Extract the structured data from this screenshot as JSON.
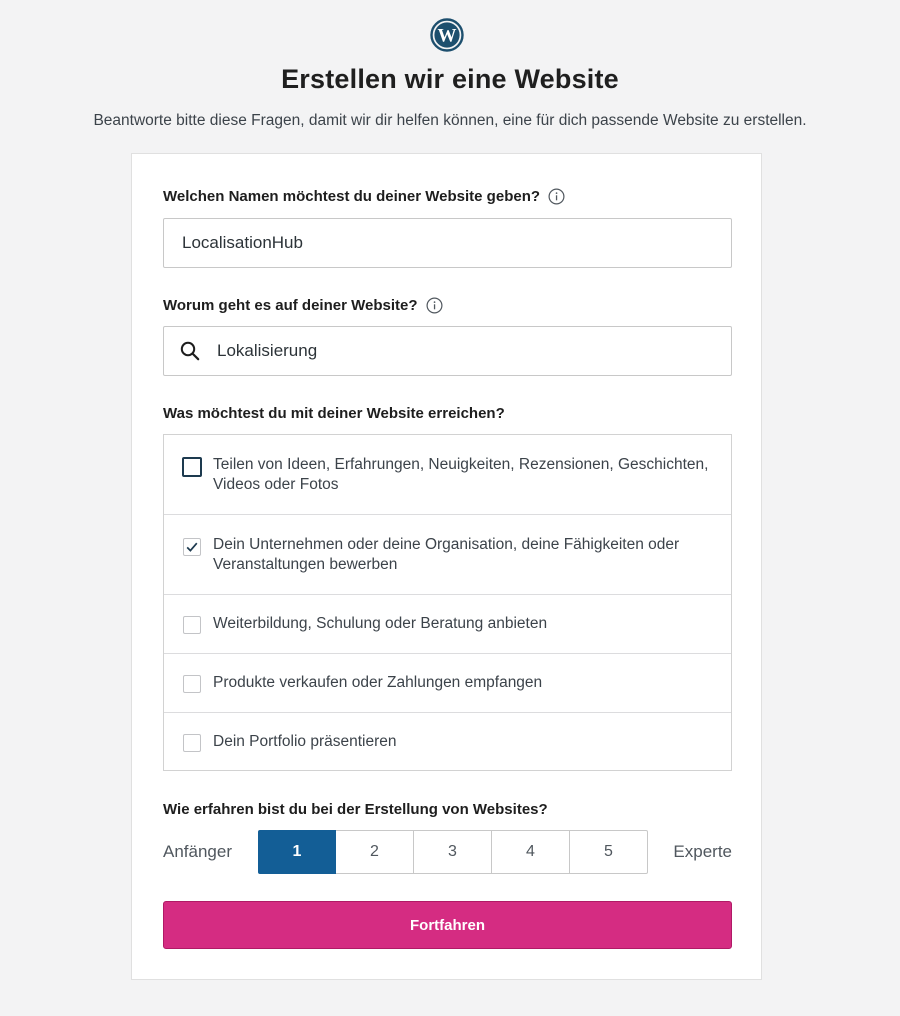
{
  "header": {
    "logo_icon": "wordpress-logo-icon",
    "title": "Erstellen wir eine Website",
    "subtitle": "Beantworte bitte diese Fragen, damit wir dir helfen können, eine für dich passende Website zu erstellen."
  },
  "form": {
    "site_name": {
      "label": "Welchen Namen möchtest du deiner Website geben?",
      "info_icon": "info-icon",
      "value": "LocalisationHub"
    },
    "site_topic": {
      "label": "Worum geht es auf deiner Website?",
      "info_icon": "info-icon",
      "search_icon": "search-icon",
      "value": "Lokalisierung"
    },
    "goals": {
      "label": "Was möchtest du mit deiner Website erreichen?",
      "options": [
        {
          "text": "Teilen von Ideen, Erfahrungen, Neuigkeiten, Rezensionen, Geschichten, Videos oder Fotos",
          "checked": false,
          "focused": true
        },
        {
          "text": "Dein Unternehmen oder deine Organisation, deine Fähigkeiten oder Veranstaltungen bewerben",
          "checked": true,
          "focused": false
        },
        {
          "text": "Weiterbildung, Schulung oder Beratung anbieten",
          "checked": false,
          "focused": false
        },
        {
          "text": "Produkte verkaufen oder Zahlungen empfangen",
          "checked": false,
          "focused": false
        },
        {
          "text": "Dein Portfolio präsentieren",
          "checked": false,
          "focused": false
        }
      ]
    },
    "experience": {
      "label": "Wie erfahren bist du bei der Erstellung von Websites?",
      "min_label": "Anfänger",
      "max_label": "Experte",
      "levels": [
        "1",
        "2",
        "3",
        "4",
        "5"
      ],
      "selected": "1"
    },
    "continue_label": "Fortfahren"
  },
  "colors": {
    "background": "#f3f3f4",
    "selected_level": "#135e96",
    "primary_button": "#d52c82"
  }
}
